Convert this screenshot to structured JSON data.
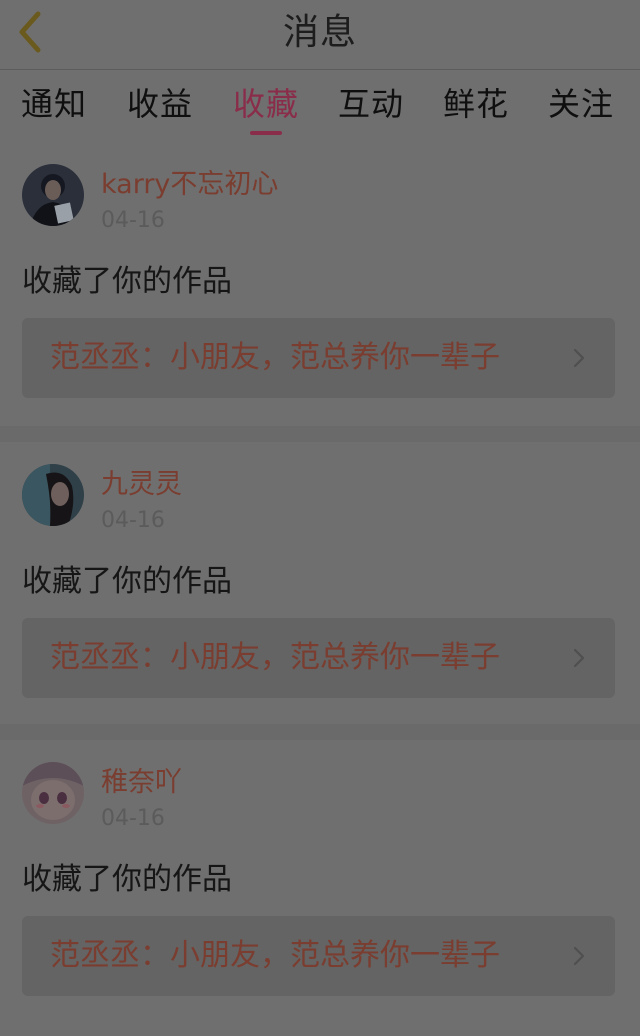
{
  "header": {
    "title": "消息"
  },
  "tabs": [
    {
      "label": "通知"
    },
    {
      "label": "收益"
    },
    {
      "label": "收藏"
    },
    {
      "label": "互动"
    },
    {
      "label": "鲜花"
    },
    {
      "label": "关注"
    }
  ],
  "active_tab": "收藏",
  "messages": [
    {
      "username": "karry不忘初心",
      "date": "04-16",
      "action": "收藏了你的作品",
      "work_title": "范丞丞：小朋友，范总养你一辈子"
    },
    {
      "username": "九灵灵",
      "date": "04-16",
      "action": "收藏了你的作品",
      "work_title": "范丞丞：小朋友，范总养你一辈子"
    },
    {
      "username": "稚奈吖",
      "date": "04-16",
      "action": "收藏了你的作品",
      "work_title": "范丞丞：小朋友，范总养你一辈子"
    }
  ],
  "colors": {
    "accent": "#8a2d4a",
    "link_text": "#7a3d2f",
    "back_icon": "#6b5a1e"
  },
  "icons": {
    "back": "chevron-left-icon",
    "link": "chevron-right-icon"
  }
}
